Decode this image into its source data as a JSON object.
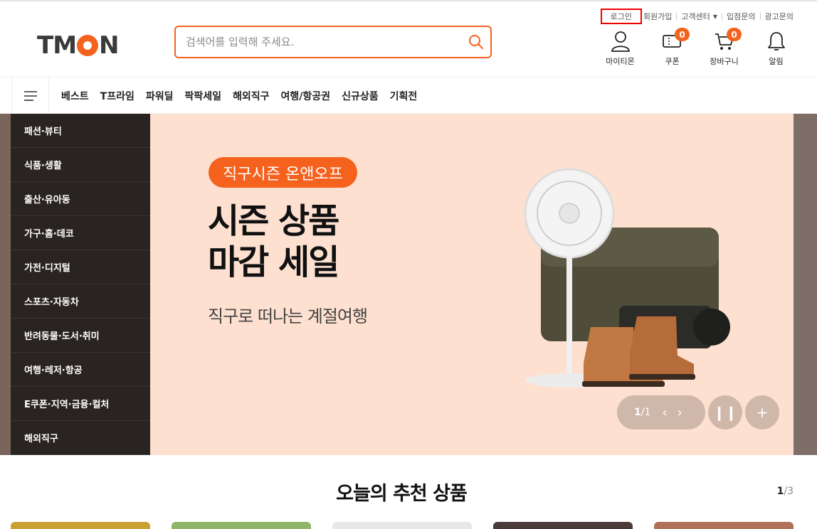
{
  "util_links": {
    "login": "로그인",
    "signup": "회원가입",
    "support": "고객센터",
    "partner": "입점문의",
    "ads": "광고문의"
  },
  "logo": {
    "pre": "TM",
    "post": "N"
  },
  "search": {
    "placeholder": "검색어를 입력해 주세요."
  },
  "header_icons": {
    "mytmon": "마이티몬",
    "coupon": "쿠폰",
    "coupon_count": "0",
    "cart": "장바구니",
    "cart_count": "0",
    "alarm": "알림"
  },
  "nav": {
    "items": [
      "베스트",
      "T프라임",
      "파워딜",
      "팍팍세일",
      "해외직구",
      "여행/항공권",
      "신규상품",
      "기획전"
    ]
  },
  "categories": [
    "패션·뷰티",
    "식품·생활",
    "출산·유아동",
    "가구·홈·데코",
    "가전·디지털",
    "스포츠·자동차",
    "반려동물·도서·취미",
    "여행·레저·항공",
    "E쿠폰·지역·금융·컬처",
    "해외직구"
  ],
  "hero": {
    "pill": "직구시즌 온앤오프",
    "title_line1": "시즌 상품",
    "title_line2": "마감 세일",
    "subtitle": "직구로 떠나는 계절여행",
    "pager": {
      "current": "1",
      "total": "/1"
    }
  },
  "recommend": {
    "title": "오늘의 추천 상품",
    "page_current": "1",
    "page_total": "/3"
  },
  "colors": {
    "accent": "#f5621e",
    "hero_bg": "#fde0d0"
  }
}
